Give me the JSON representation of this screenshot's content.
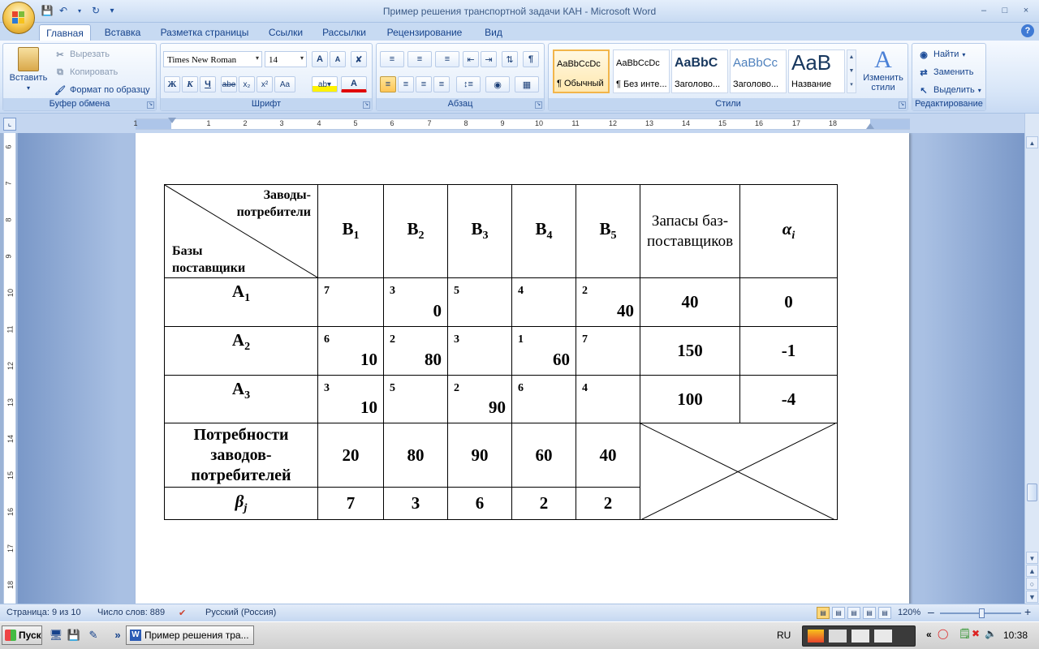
{
  "window": {
    "title": "Пример решения транспортной задачи КАН - Microsoft Word",
    "controls": [
      "–",
      "□",
      "×"
    ]
  },
  "quick_access": {
    "dropdown": "▾"
  },
  "tabs": [
    {
      "label": "Главная",
      "active": true
    },
    {
      "label": "Вставка"
    },
    {
      "label": "Разметка страницы"
    },
    {
      "label": "Ссылки"
    },
    {
      "label": "Рассылки"
    },
    {
      "label": "Рецензирование"
    },
    {
      "label": "Вид"
    }
  ],
  "help_label": "?",
  "ribbon": {
    "clipboard": {
      "group_label": "Буфер обмена",
      "paste": "Вставить",
      "cut": "Вырезать",
      "copy": "Копировать",
      "format_painter": "Формат по образцу"
    },
    "font": {
      "group_label": "Шрифт",
      "font_name": "Times New Roman",
      "font_size": "14",
      "buttons": {
        "bold": "Ж",
        "italic": "К",
        "underline": "Ч",
        "strike": "abe",
        "subscript": "x₂",
        "superscript": "x²",
        "change_case": "Aa",
        "grow": "A",
        "shrink": "A",
        "font_color": "A"
      }
    },
    "paragraph": {
      "group_label": "Абзац",
      "pilcrow": "¶"
    },
    "styles": {
      "group_label": "Стили",
      "items": [
        {
          "sample": "AaBbCcDc",
          "name": "¶ Обычный",
          "selected": true
        },
        {
          "sample": "AaBbCcDc",
          "name": "¶ Без инте..."
        },
        {
          "sample": "AaBbC",
          "name": "Заголово..."
        },
        {
          "sample": "AaBbCc",
          "name": "Заголово..."
        },
        {
          "sample": "AaB",
          "name": "Название"
        }
      ],
      "change_styles": "Изменить стили"
    },
    "editing": {
      "group_label": "Редактирование",
      "find": "Найти",
      "replace": "Заменить",
      "select": "Выделить"
    }
  },
  "ruler": {
    "horizontal": [
      "1",
      "1",
      "2",
      "3",
      "4",
      "5",
      "6",
      "7",
      "8",
      "9",
      "10",
      "11",
      "12",
      "13",
      "14",
      "15",
      "16",
      "17",
      "18"
    ],
    "vertical": [
      "6",
      "7",
      "8",
      "9",
      "10",
      "11",
      "12",
      "13",
      "14",
      "15",
      "16",
      "17",
      "18"
    ]
  },
  "table": {
    "corner": {
      "top": "Заводы-потребители",
      "bottom": "Базы поставщики"
    },
    "consumers": [
      {
        "letter": "B",
        "index": "1"
      },
      {
        "letter": "B",
        "index": "2"
      },
      {
        "letter": "B",
        "index": "3"
      },
      {
        "letter": "B",
        "index": "4"
      },
      {
        "letter": "B",
        "index": "5"
      }
    ],
    "supply_header": "Запасы баз-поставщиков",
    "alpha_header": {
      "letter": "α",
      "index": "i"
    },
    "rows": [
      {
        "letter": "A",
        "index": "1",
        "cells": [
          {
            "cost": "7",
            "alloc": ""
          },
          {
            "cost": "3",
            "alloc": "0"
          },
          {
            "cost": "5",
            "alloc": ""
          },
          {
            "cost": "4",
            "alloc": ""
          },
          {
            "cost": "2",
            "alloc": "40"
          }
        ],
        "supply": "40",
        "alpha": "0"
      },
      {
        "letter": "A",
        "index": "2",
        "cells": [
          {
            "cost": "6",
            "alloc": "10"
          },
          {
            "cost": "2",
            "alloc": "80"
          },
          {
            "cost": "3",
            "alloc": ""
          },
          {
            "cost": "1",
            "alloc": "60"
          },
          {
            "cost": "7",
            "alloc": ""
          }
        ],
        "supply": "150",
        "alpha": "-1"
      },
      {
        "letter": "A",
        "index": "3",
        "cells": [
          {
            "cost": "3",
            "alloc": "10"
          },
          {
            "cost": "5",
            "alloc": ""
          },
          {
            "cost": "2",
            "alloc": "90"
          },
          {
            "cost": "6",
            "alloc": ""
          },
          {
            "cost": "4",
            "alloc": ""
          }
        ],
        "supply": "100",
        "alpha": "-4"
      }
    ],
    "demand_label": "Потребности заводов-потребителей",
    "demand": [
      "20",
      "80",
      "90",
      "60",
      "40"
    ],
    "beta_label": {
      "letter": "β",
      "index": "j"
    },
    "beta": [
      "7",
      "3",
      "6",
      "2",
      "2"
    ]
  },
  "statusbar": {
    "page": "Страница: 9 из 10",
    "words": "Число слов: 889",
    "language": "Русский (Россия)",
    "zoom": "120%",
    "zoom_minus": "–",
    "zoom_plus": "+"
  },
  "taskbar": {
    "start": "Пуск",
    "task": "Пример решения тра...",
    "chevron": "»",
    "lang": "RU",
    "time": "10:38"
  }
}
